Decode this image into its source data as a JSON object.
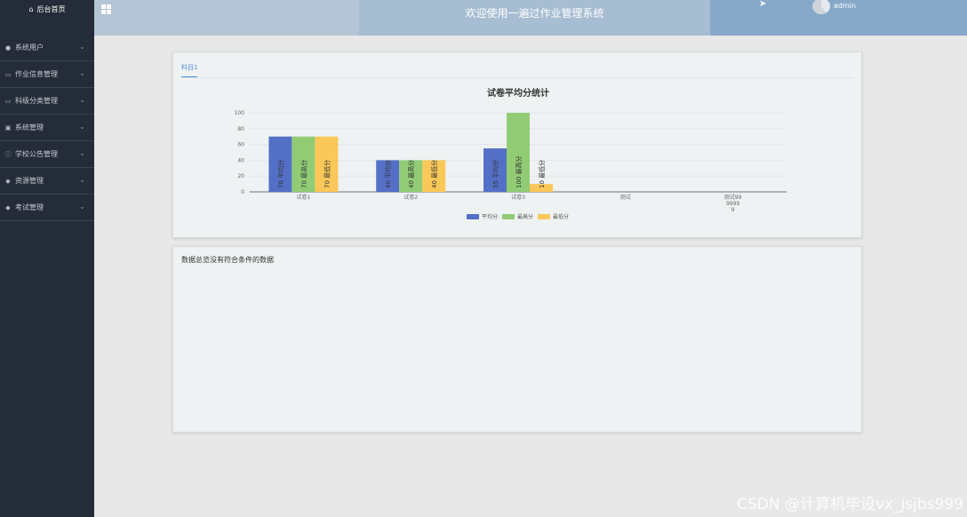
{
  "sidebar": {
    "home_label": "后台首页",
    "items": [
      {
        "label": "系统用户",
        "icon": "user-icon"
      },
      {
        "label": "作业信息管理",
        "icon": "doc-icon"
      },
      {
        "label": "科级分类管理",
        "icon": "doc-icon"
      },
      {
        "label": "系统管理",
        "icon": "image-icon"
      },
      {
        "label": "学校公告管理",
        "icon": "info-icon"
      },
      {
        "label": "资源管理",
        "icon": "location-icon"
      },
      {
        "label": "考试管理",
        "icon": "location-icon"
      }
    ]
  },
  "header": {
    "title": "欢迎使用一遍过作业管理系统",
    "username": "admin"
  },
  "panel1": {
    "tab_label": "科目1"
  },
  "chart_data": {
    "type": "bar",
    "title": "试卷平均分统计",
    "categories": [
      "试卷1",
      "试卷2",
      "试卷3",
      "测试",
      "测试99\n9999\n9"
    ],
    "ylim": [
      0,
      100
    ],
    "yticks": [
      0,
      20,
      40,
      60,
      80,
      100
    ],
    "grid": true,
    "legend_position": "bottom",
    "series": [
      {
        "name": "平均分",
        "values": [
          70,
          40,
          55,
          null,
          null
        ],
        "color": "#5470c6"
      },
      {
        "name": "最高分",
        "values": [
          70,
          40,
          100,
          null,
          null
        ],
        "color": "#91cc75"
      },
      {
        "name": "最低分",
        "values": [
          70,
          40,
          10,
          null,
          null
        ],
        "color": "#fac858"
      }
    ]
  },
  "panel2": {
    "empty_text": "数据总览没有符合条件的数据"
  },
  "watermark": "CSDN @计算机毕设vx_jsjbs999"
}
